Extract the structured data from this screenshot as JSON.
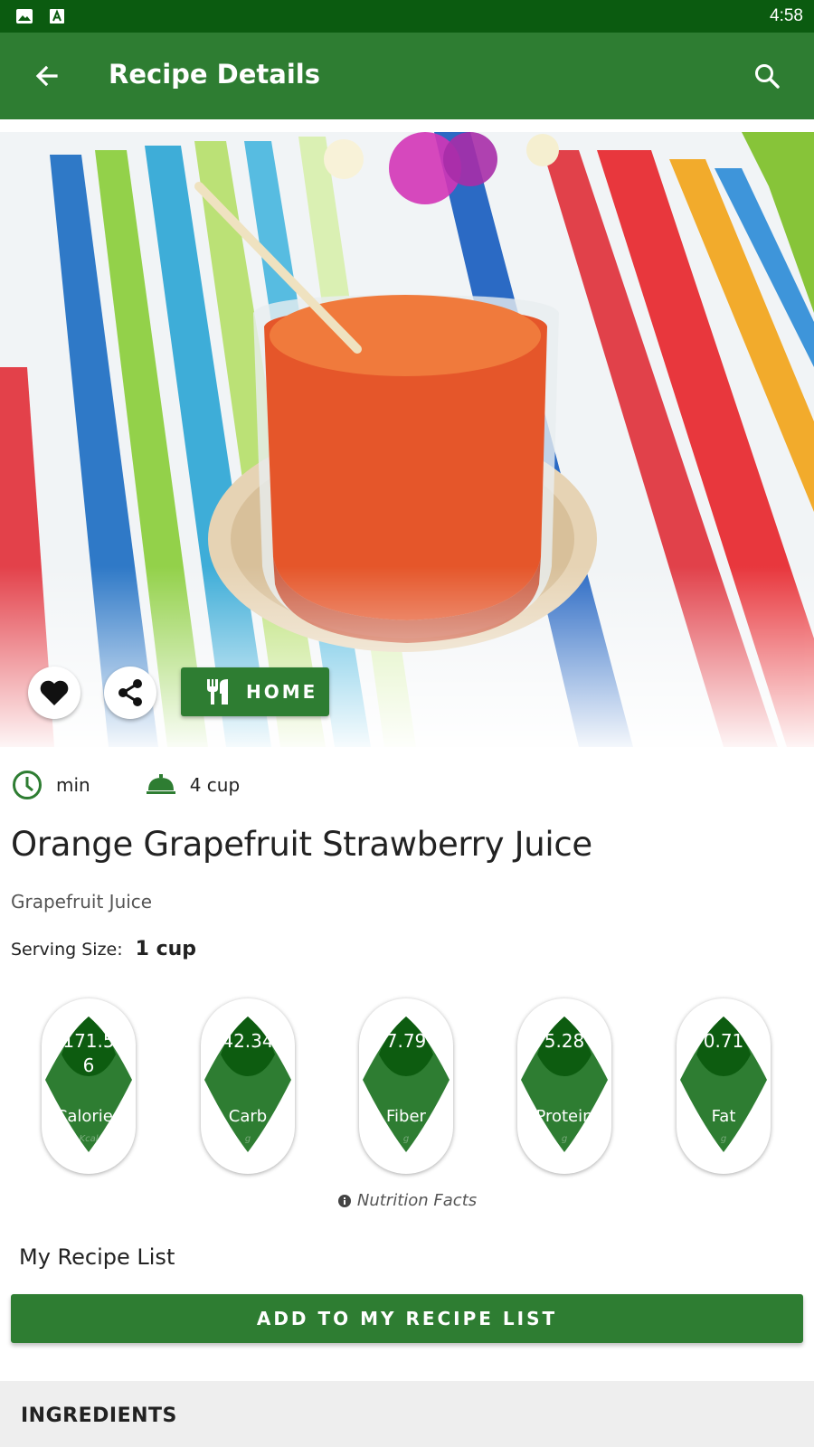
{
  "status_bar": {
    "time": "4:58",
    "icons": [
      "image-icon",
      "font-icon"
    ]
  },
  "app_bar": {
    "title": "Recipe Details",
    "back_icon": "arrow-back-icon",
    "search_icon": "search-icon"
  },
  "hero": {
    "image_subject": "glass of orange juice with straw on striped tablecloth"
  },
  "actions": {
    "favorite_icon": "heart-icon",
    "share_icon": "share-icon",
    "home_label": "HOME",
    "home_icon": "restaurant-icon"
  },
  "meta": {
    "time_value": "min",
    "servings_value": "4 cup"
  },
  "recipe": {
    "title": "Orange Grapefruit Strawberry Juice",
    "category": "Grapefruit Juice",
    "serving_label": "Serving Size:",
    "serving_value": "1 cup"
  },
  "nutrition": [
    {
      "value_line1": "171.5",
      "value_line2": "6",
      "name": "Calories",
      "unit": "Kcal"
    },
    {
      "value_line1": "42.34",
      "value_line2": "",
      "name": "Carb",
      "unit": "g"
    },
    {
      "value_line1": "7.79",
      "value_line2": "",
      "name": "Fiber",
      "unit": "g"
    },
    {
      "value_line1": "5.28",
      "value_line2": "",
      "name": "Protein",
      "unit": "g"
    },
    {
      "value_line1": "0.71",
      "value_line2": "",
      "name": "Fat",
      "unit": "g"
    }
  ],
  "nutrition_facts_label": "Nutrition Facts",
  "my_list": {
    "title": "My Recipe List",
    "add_button": "ADD TO MY RECIPE LIST"
  },
  "ingredients": {
    "heading": "INGREDIENTS"
  },
  "colors": {
    "primary": "#2e7d32",
    "primary_dark": "#0b5b10",
    "leaf_dark": "#0d5c10"
  }
}
